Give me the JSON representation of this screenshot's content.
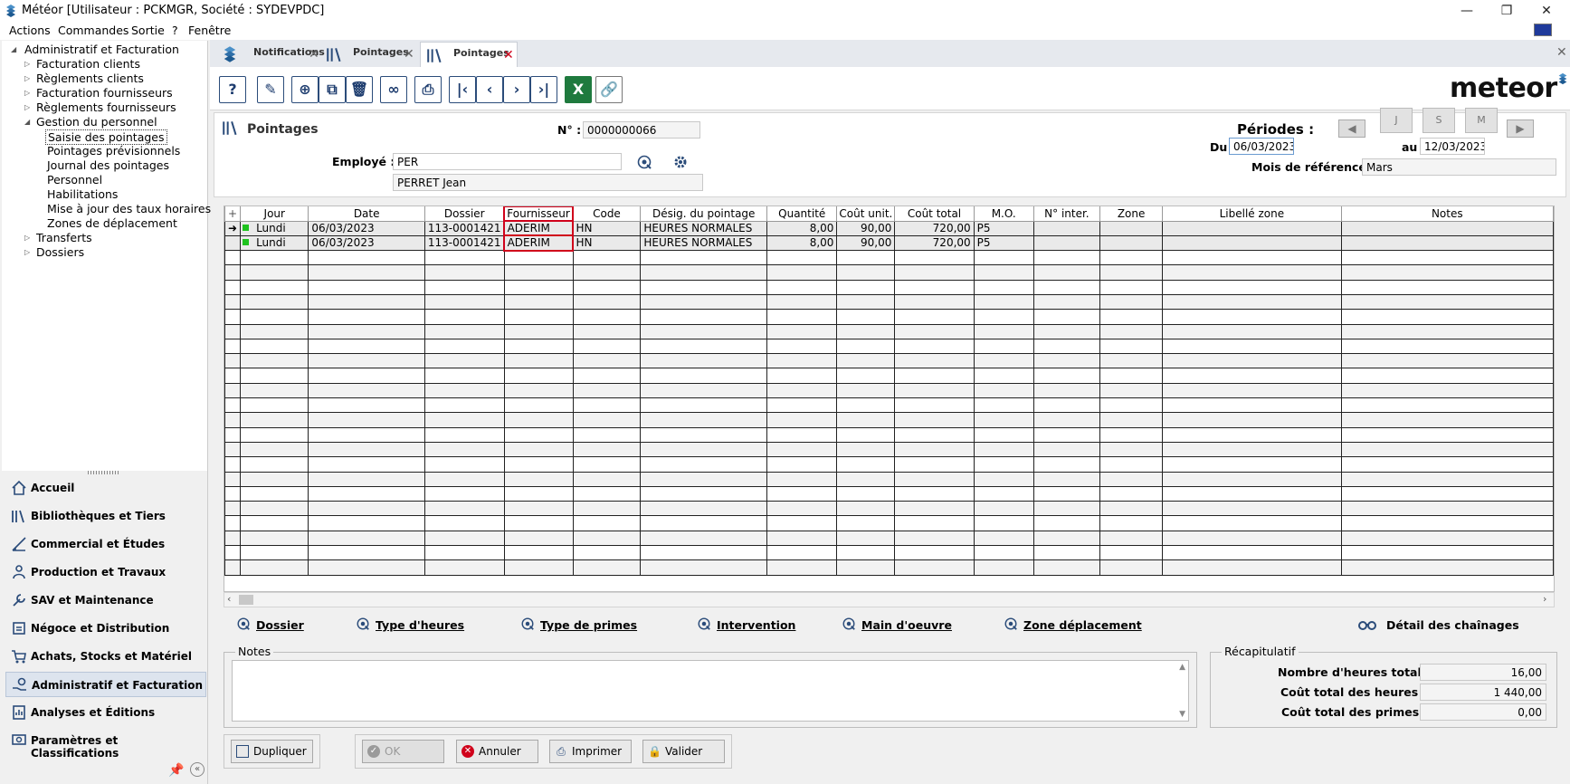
{
  "window": {
    "title": "Météor [Utilisateur : PCKMGR, Société : SYDEVPDC]"
  },
  "menu": [
    "Actions",
    "Commandes",
    "Sortie",
    "?",
    "Fenêtre"
  ],
  "tree": {
    "root": "Administratif et Facturation",
    "items": [
      "Facturation clients",
      "Règlements clients",
      "Facturation fournisseurs",
      "Règlements fournisseurs"
    ],
    "group": "Gestion du personnel",
    "subitems": [
      "Saisie des pointages",
      "Pointages prévisionnels",
      "Journal des pointages",
      "Personnel",
      "Habilitations",
      "Mise à jour des taux horaires",
      "Zones de déplacement"
    ],
    "after": [
      "Transferts",
      "Dossiers"
    ]
  },
  "nav": [
    "Accueil",
    "Bibliothèques et Tiers",
    "Commercial et Études",
    "Production et Travaux",
    "SAV et Maintenance",
    "Négoce et Distribution",
    "Achats, Stocks et Matériel",
    "Administratif et Facturation",
    "Analyses et Éditions",
    "Paramètres et Classifications"
  ],
  "tabs": [
    {
      "label": "Notifications"
    },
    {
      "label": "Pointages"
    },
    {
      "label": "Pointages"
    }
  ],
  "brand": "meteor",
  "form": {
    "title": "Pointages",
    "no_label": "N° :",
    "no_value": "0000000066",
    "employe_label": "Employé :",
    "employe_code": "PER",
    "employe_name": "PERRET  Jean",
    "periodes_label": "Périodes :",
    "du_label": "Du",
    "du_value": "06/03/2023",
    "au_label": "au",
    "au_value": "12/03/2023",
    "mois_label": "Mois de référence :",
    "mois_value": "Mars"
  },
  "grid": {
    "columns": [
      "Jour",
      "Date",
      "Dossier",
      "Fournisseur",
      "Code",
      "Désig. du pointage",
      "Quantité",
      "Coût unit.",
      "Coût total",
      "M.O.",
      "N° inter.",
      "Zone",
      "Libellé zone",
      "Notes"
    ],
    "rows": [
      [
        "Lundi",
        "06/03/2023",
        "113-0001421",
        "ADERIM",
        "HN",
        "HEURES NORMALES",
        "8,00",
        "90,00",
        "720,00",
        "P5",
        "",
        "",
        "",
        ""
      ],
      [
        "Lundi",
        "06/03/2023",
        "113-0001421",
        "ADERIM",
        "HN",
        "HEURES NORMALES",
        "8,00",
        "90,00",
        "720,00",
        "P5",
        "",
        "",
        "",
        ""
      ]
    ]
  },
  "links": [
    "Dossier",
    "Type d'heures",
    "Type de primes",
    "Intervention",
    "Main d'oeuvre",
    "Zone déplacement",
    "Détail des chaînages"
  ],
  "notes": {
    "title": "Notes"
  },
  "recap": {
    "title": "Récapitulatif",
    "heures_label": "Nombre d'heures total :",
    "heures_value": "16,00",
    "cout_heures_label": "Coût total des heures :",
    "cout_heures_value": "1 440,00",
    "cout_primes_label": "Coût total des primes :",
    "cout_primes_value": "0,00"
  },
  "buttons": {
    "dupliquer": "Dupliquer",
    "ok": "OK",
    "annuler": "Annuler",
    "imprimer": "Imprimer",
    "valider": "Valider"
  }
}
